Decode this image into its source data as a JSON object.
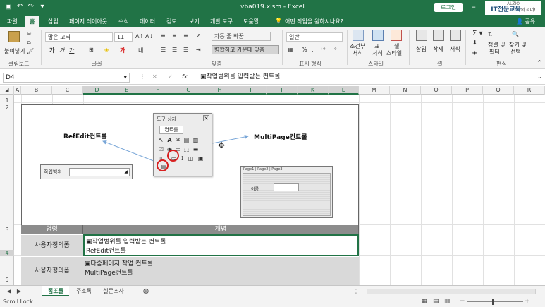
{
  "titlebar": {
    "title": "vba019.xlsm - Excel",
    "login": "로그인",
    "logo_small": "ALZIO",
    "logo_main": "IT전문교육",
    "logo_suffix": "의 리더!"
  },
  "tabs": [
    "파일",
    "홈",
    "삽입",
    "페이지 레이아웃",
    "수식",
    "데이터",
    "검토",
    "보기",
    "개발 도구",
    "도움말",
    "어떤 작업을 원하시나요?"
  ],
  "share": "공유",
  "ribbon": {
    "paste": "붙여넣기",
    "clipboard": "클립보드",
    "font_name": "맑은 고딕",
    "font_size": "11",
    "font_group": "글꼴",
    "wrap": "자동 줄 바꿈",
    "merge": "병합하고 가운데 맞춤",
    "align_group": "맞춤",
    "number_format": "일반",
    "number_group": "표시 형식",
    "percent": "%",
    "cond": "조건부",
    "cond2": "서식",
    "table": "표",
    "table2": "서식",
    "cellstyle": "셀",
    "cellstyle2": "스타일",
    "style_group": "스타일",
    "insert": "삽입",
    "delete": "삭제",
    "format": "서식",
    "cells_group": "셀",
    "sort": "정렬 및",
    "sort2": "필터",
    "find": "찾기 및",
    "find2": "선택",
    "edit_group": "편집"
  },
  "formula_bar": {
    "cell": "D4",
    "fx": "fx",
    "content": "▣작업범위를 입력받는 컨트롤"
  },
  "columns": [
    "A",
    "B",
    "C",
    "D",
    "E",
    "F",
    "G",
    "H",
    "I",
    "J",
    "K",
    "L",
    "M",
    "N",
    "O",
    "P",
    "Q",
    "R"
  ],
  "rows": [
    "1",
    "2",
    "3",
    "4",
    "5"
  ],
  "toolbox": {
    "title": "도구 상자",
    "tab": "컨트롤"
  },
  "callouts": {
    "refedit": "RefEdit컨트롤",
    "multipage": "MultiPage컨트롤"
  },
  "refpanel": {
    "label": "작업범위"
  },
  "multipage": {
    "tabs": "Page1 | Page2 | Page3",
    "label": "이름"
  },
  "table": {
    "headers": [
      "명령",
      "개념"
    ],
    "rows": [
      {
        "name": "사용자정의폼",
        "line1": "▣작업범위를 입력받는 컨트롤",
        "line2": "RefEdit컨트롤"
      },
      {
        "name": "사용자정의폼",
        "line1": "▣다중페이지 작업 컨트롤",
        "line2": "MultiPage컨트롤"
      }
    ]
  },
  "sheets": [
    "폼조들",
    "주소록",
    "설문조사"
  ],
  "status": {
    "left": "Scroll Lock"
  },
  "colors": {
    "excel_green": "#217346",
    "circle_red": "#d82020",
    "arrow_blue": "#7aa7d8"
  }
}
